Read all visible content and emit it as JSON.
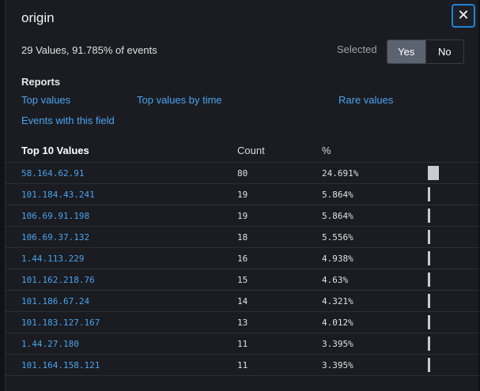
{
  "header": {
    "title": "origin",
    "close_glyph": "✕"
  },
  "summary": {
    "text": "29 Values, 91.785% of events"
  },
  "selected": {
    "label": "Selected",
    "yes": "Yes",
    "no": "No",
    "active": "Yes"
  },
  "reports": {
    "heading": "Reports",
    "links": [
      "Top values",
      "Top values by time",
      "Rare values",
      "Events with this field"
    ]
  },
  "table": {
    "headers": {
      "value": "Top 10 Values",
      "count": "Count",
      "percent": "%"
    },
    "rows": [
      {
        "value": "58.164.62.91",
        "count": "80",
        "percent": "24.691%",
        "fraction": 0.24691
      },
      {
        "value": "101.184.43.241",
        "count": "19",
        "percent": "5.864%",
        "fraction": 0.05864
      },
      {
        "value": "106.69.91.198",
        "count": "19",
        "percent": "5.864%",
        "fraction": 0.05864
      },
      {
        "value": "106.69.37.132",
        "count": "18",
        "percent": "5.556%",
        "fraction": 0.05556
      },
      {
        "value": "1.44.113.229",
        "count": "16",
        "percent": "4.938%",
        "fraction": 0.04938
      },
      {
        "value": "101.162.218.76",
        "count": "15",
        "percent": "4.63%",
        "fraction": 0.0463
      },
      {
        "value": "101.186.67.24",
        "count": "14",
        "percent": "4.321%",
        "fraction": 0.04321
      },
      {
        "value": "101.183.127.167",
        "count": "13",
        "percent": "4.012%",
        "fraction": 0.04012
      },
      {
        "value": "1.44.27.180",
        "count": "11",
        "percent": "3.395%",
        "fraction": 0.03395
      },
      {
        "value": "101.164.158.121",
        "count": "11",
        "percent": "3.395%",
        "fraction": 0.03395
      }
    ]
  },
  "colors": {
    "link": "#4aa3f0",
    "accent_border": "#1f84d6",
    "toggle_active": "#5b6370",
    "bar": "#c8ccd2",
    "panel_bg": "#1a1c21"
  }
}
